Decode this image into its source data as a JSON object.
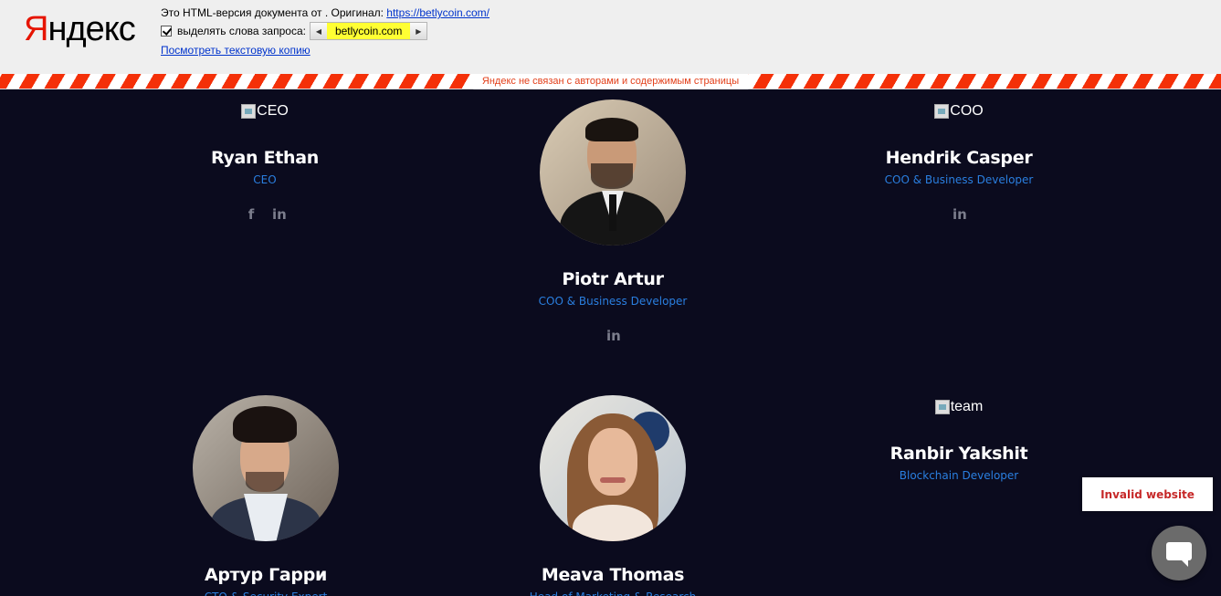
{
  "yandex": {
    "logo_first": "Я",
    "logo_rest": "ндекс",
    "info_prefix": "Это HTML-версия документа от . Оригинал: ",
    "original_url": "https://betlycoin.com/",
    "highlight_label": "выделять слова запроса:",
    "highlight_word": "betlycoin.com",
    "text_copy_link": "Посмотреть текстовую копию",
    "disclaimer": "Яндекс не связан с авторами и содержимым страницы",
    "prev_icon": "triangle-left-icon",
    "next_icon": "triangle-right-icon"
  },
  "team": [
    {
      "alt": "CEO",
      "name": "Ryan Ethan",
      "role": "CEO",
      "socials": [
        "f",
        "in"
      ]
    },
    {
      "alt": "",
      "name": "Piotr Artur",
      "role": "COO & Business Developer",
      "socials": [
        "in"
      ]
    },
    {
      "alt": "COO",
      "name": "Hendrik Casper",
      "role": "COO & Business Developer",
      "socials": [
        "in"
      ]
    },
    {
      "alt": "",
      "name": "Артур Гарри",
      "role": "CTO & Security Expert"
    },
    {
      "alt": "",
      "name": "Meava Thomas",
      "role": "Head of Marketing & Research"
    },
    {
      "alt": "team",
      "name": "Ranbir Yakshit",
      "role": "Blockchain Developer"
    }
  ],
  "widgets": {
    "invalid_label": "Invalid website",
    "chat_icon": "chat-bubble-icon"
  },
  "colors": {
    "page_bg": "#0b0b1e",
    "role_blue": "#2a7fe0",
    "stripe_red": "#f43008",
    "yandex_red": "#e61400"
  }
}
